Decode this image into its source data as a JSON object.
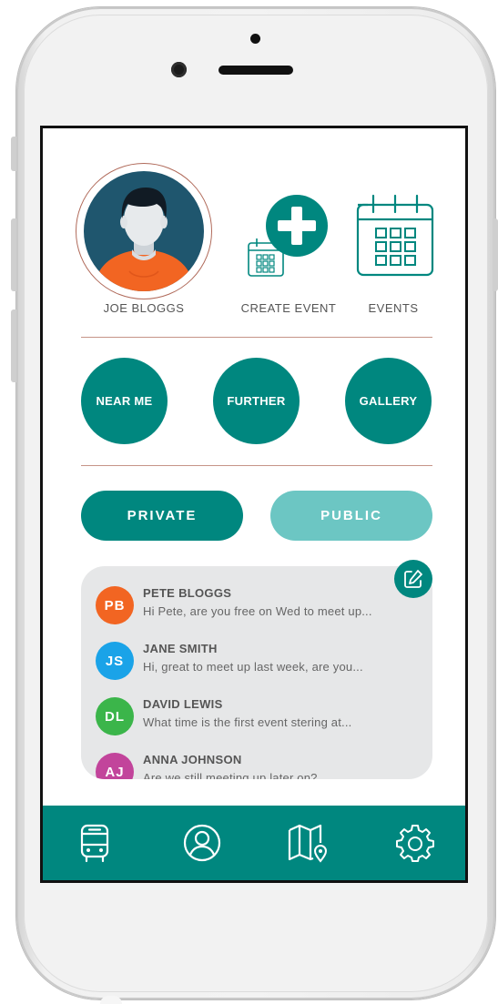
{
  "profile": {
    "name": "JOE BLOGGS"
  },
  "actions": {
    "create_event_label": "CREATE EVENT",
    "events_label": "EVENTS"
  },
  "discover": {
    "near_me": "NEAR ME",
    "further": "FURTHER",
    "gallery": "GALLERY"
  },
  "visibility_toggle": {
    "private": "PRIVATE",
    "public": "PUBLIC",
    "selected": "PRIVATE"
  },
  "messages": [
    {
      "initials": "PB",
      "name": "PETE BLOGGS",
      "preview": "Hi Pete, are you free on Wed to meet up...",
      "color": "#f26522"
    },
    {
      "initials": "JS",
      "name": "JANE SMITH",
      "preview": "Hi, great to meet up last week, are you...",
      "color": "#1aa3e8"
    },
    {
      "initials": "DL",
      "name": "DAVID LEWIS",
      "preview": "What time is the first event stering at...",
      "color": "#3bb54a"
    },
    {
      "initials": "AJ",
      "name": "ANNA JOHNSON",
      "preview": "Are we still meeting up later on?",
      "color": "#c2449b"
    }
  ],
  "tabbar": {
    "items": [
      {
        "id": "transport",
        "icon": "bus-icon"
      },
      {
        "id": "profile",
        "icon": "user-circle-icon"
      },
      {
        "id": "map",
        "icon": "map-pin-icon"
      },
      {
        "id": "settings",
        "icon": "gear-icon"
      }
    ]
  },
  "colors": {
    "primary": "#00877f",
    "primary_light": "#6cc6c3",
    "divider": "#c69487",
    "avatar_bg": "#1f566e",
    "shirt": "#f26522",
    "panel": "#e6e7e8"
  }
}
